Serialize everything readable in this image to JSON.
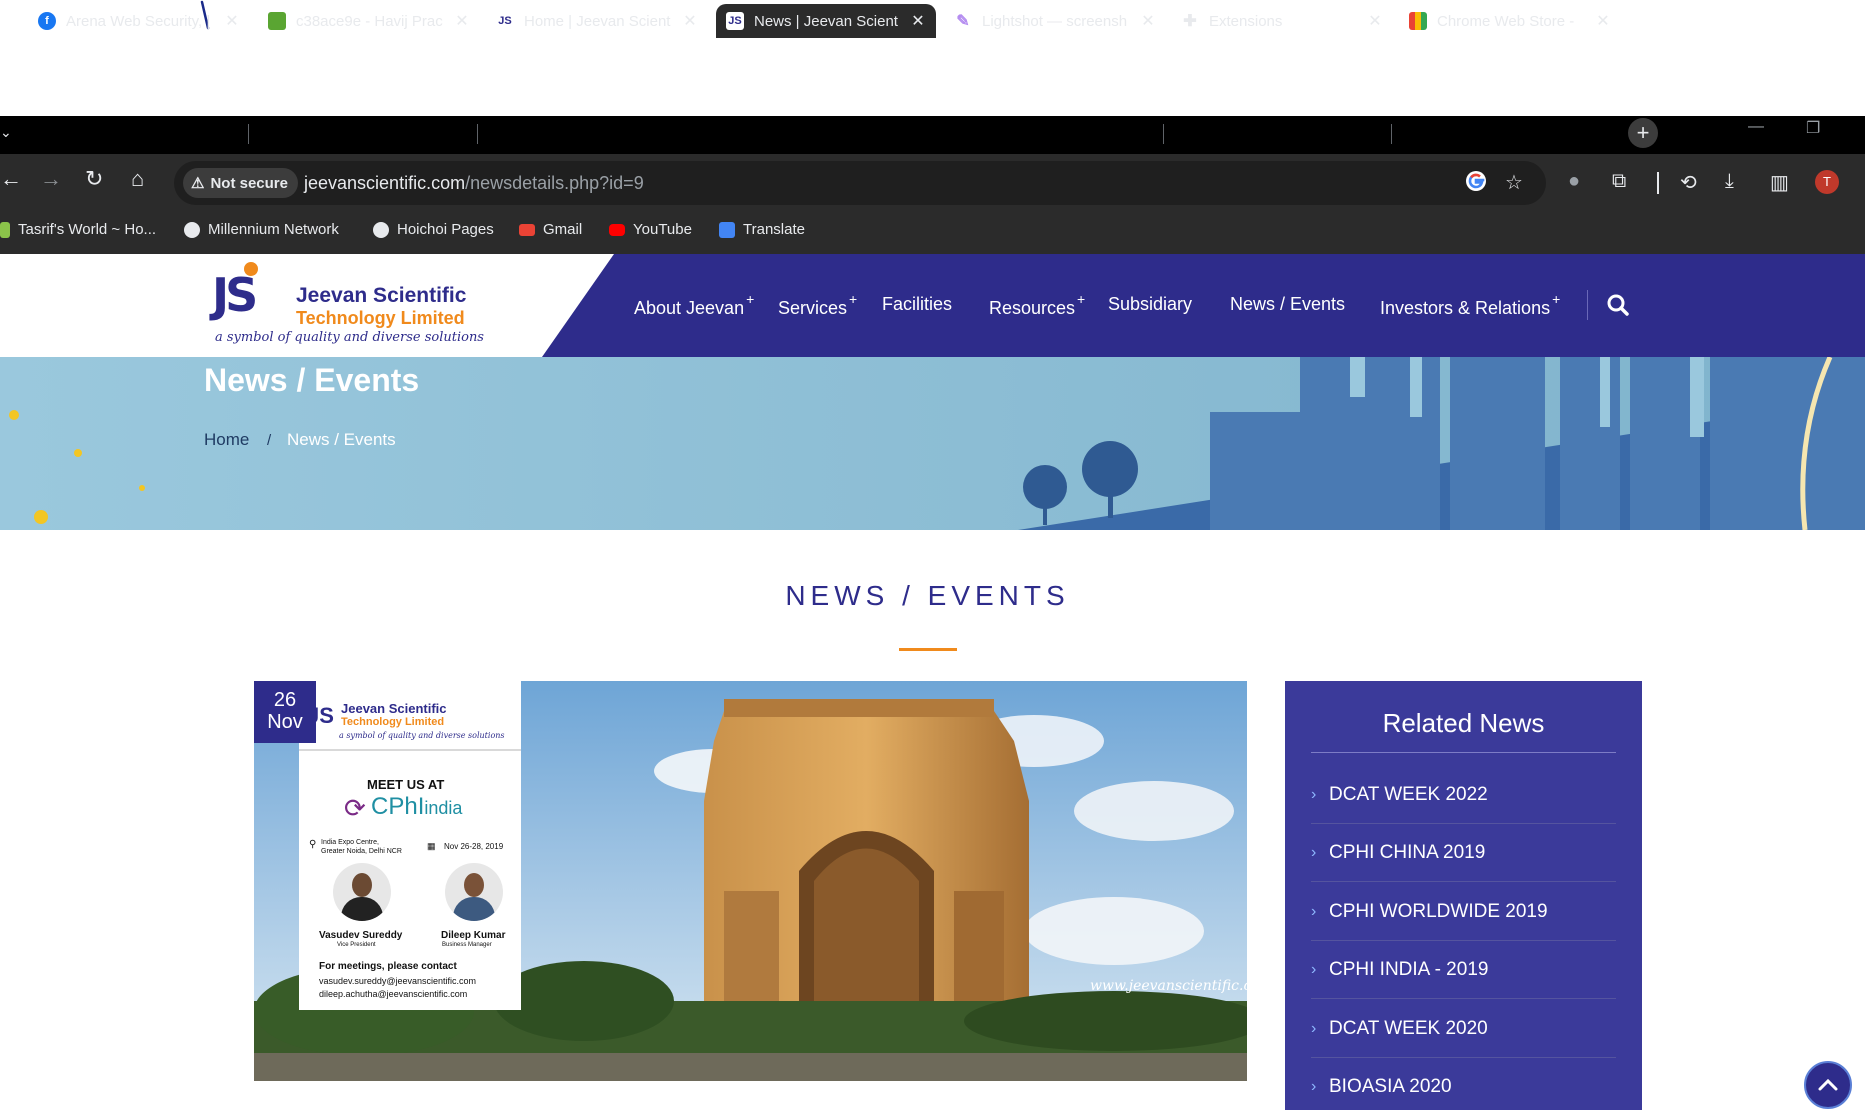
{
  "browser": {
    "tabs": [
      {
        "title": "Arena Web Security, |",
        "favicon": "facebook-icon",
        "active": false
      },
      {
        "title": "c38ace9e - Havij Prac",
        "favicon": "havij-icon",
        "active": false
      },
      {
        "title": "Home | Jeevan Scient",
        "favicon": "js-icon",
        "active": false
      },
      {
        "title": "News | Jeevan Scient",
        "favicon": "js-icon",
        "active": true
      },
      {
        "title": "Lightshot — screensh",
        "favicon": "feather-icon",
        "active": false
      },
      {
        "title": "Extensions",
        "favicon": "puzzle-icon",
        "active": false
      },
      {
        "title": "Chrome Web Store -",
        "favicon": "webstore-icon",
        "active": false
      }
    ],
    "new_tab": "+",
    "security_label": "Not secure",
    "url_host": "jeevanscientific.com",
    "url_path": "/newsdetails.php?id=9",
    "profile_initial": "T",
    "bookmarks": [
      {
        "label": "Tasrif's World ~ Ho...",
        "icon": "blogger-icon"
      },
      {
        "label": "Millennium Network",
        "icon": "globe-icon"
      },
      {
        "label": "Hoichoi Pages",
        "icon": "globe-icon"
      },
      {
        "label": "Gmail",
        "icon": "gmail-icon"
      },
      {
        "label": "YouTube",
        "icon": "youtube-icon"
      },
      {
        "label": "Translate",
        "icon": "translate-icon"
      }
    ]
  },
  "site": {
    "logo": {
      "mark": "JS",
      "name_line1": "Jeevan Scientific",
      "name_line2": "Technology Limited",
      "tagline": "a symbol of quality and diverse solutions"
    },
    "nav": [
      {
        "label": "About Jeevan",
        "plus": "+"
      },
      {
        "label": "Services",
        "plus": "+"
      },
      {
        "label": "Facilities",
        "plus": ""
      },
      {
        "label": "Resources",
        "plus": "+"
      },
      {
        "label": "Subsidiary",
        "plus": ""
      },
      {
        "label": "News / Events",
        "plus": ""
      },
      {
        "label": "Investors & Relations",
        "plus": "+"
      }
    ],
    "colors": {
      "primary": "#2e2c8b",
      "accent": "#f08a1c"
    }
  },
  "hero": {
    "title": "News / Events",
    "breadcrumb_home": "Home",
    "breadcrumb_sep": "/",
    "breadcrumb_current": "News / Events"
  },
  "content": {
    "section_title": "NEWS / EVENTS",
    "date_day": "26",
    "date_month": "Nov",
    "poster": {
      "company1": "Jeevan Scientific",
      "company2": "Technology Limited",
      "tagline": "a symbol of quality and diverse solutions",
      "meet": "MEET US AT",
      "event_name": "CPhI",
      "event_suffix": "india",
      "venue1": "India Expo Centre,",
      "venue2": "Greater Noida, Delhi NCR",
      "dates": "Nov 26-28, 2019",
      "person1_name": "Vasudev Sureddy",
      "person1_role": "Vice President",
      "person2_name": "Dileep Kumar",
      "person2_role": "Business Manager",
      "contact_heading": "For meetings, please contact",
      "email1": "vasudev.sureddy@jeevanscientific.com",
      "email2": "dileep.achutha@jeevanscientific.com"
    },
    "watermark": "www.jeevanscientific.com"
  },
  "related": {
    "title": "Related News",
    "items": [
      "DCAT WEEK 2022",
      "CPHI CHINA 2019",
      "CPHI WORLDWIDE 2019",
      "CPHI INDIA - 2019",
      "DCAT WEEK 2020",
      "BIOASIA 2020"
    ]
  }
}
